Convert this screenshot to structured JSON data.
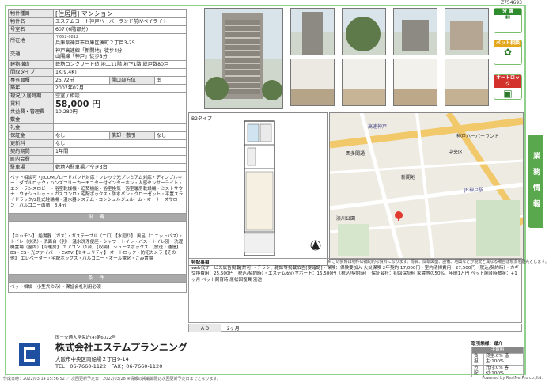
{
  "doc_id": "Z754693",
  "property": {
    "type_label": "物件種目",
    "type_value": "[住居用] マンション",
    "name_label": "物件名",
    "name_value": "エステムコート神戸ハーバーランド前IVベイライト",
    "room_label": "号室名",
    "room_value": "607 (6階部分)",
    "address_label": "所在地",
    "address_zip": "〒652-0812",
    "address_value": "兵庫県神戸市兵庫区湊町２丁目3-25",
    "traffic_label": "交通",
    "traffic_1": "神戸高速線「新開地」徒歩4分",
    "traffic_2": "山陽線「神戸」徒歩8分",
    "structure_label": "建物構造",
    "structure_value": "鉄筋コンクリート造 地上11階 地下1階 総戸数80戸",
    "layout_label": "間取タイプ",
    "layout_value": "1K[9.4K]",
    "area_label": "専有面積",
    "area_value": "25.72㎡",
    "direction_label": "開口部方位",
    "direction_value": "南",
    "built_label": "築年",
    "built_value": "2007年02月",
    "status_label": "現況/入居時期",
    "status_value": "空室 / 相談",
    "rent_label": "賃料",
    "rent_value": "58,000 円",
    "mgmt_label": "共益費・管理費",
    "mgmt_value": "10,280円",
    "deposit_label": "敷金",
    "deposit_value": "",
    "key_label": "礼金",
    "key_value": "",
    "guarantee_label": "保証金",
    "guarantee_value": "なし",
    "amort_label": "償却・敷引",
    "amort_value": "なし",
    "renew_label": "更新料",
    "renew_value": "なし",
    "contract_label": "契約期間",
    "contract_value": "1年間",
    "town_label": "町内会費",
    "town_value": "",
    "parking_label": "駐車場",
    "parking_value": "敷地内駐車場／空き3台"
  },
  "features_text": "ペット相談可・J:COMブロードバンド対応・フレッツ光プレミアム対応・ディンプルキー・ダブルロック・ハンズフリーカーモニター付インターホン・人感センサーライト・エントランスロビー・浴室乾燥機・追焚機能・浴室換気・浴室暖房乾燥機・ミストサウナ・ウォシュレット・ガスコンロ・宅配ボックス・防水パン・クローゼット・平置スライドラック/2段式駐輪場・温水器システム・コンシェルジュルーム・オーナーズサロン・バルコニー面積：3.4㎡",
  "equipment_title": "設 備",
  "equipment_text": "【キッチン】 給湯器（ガス）・ガステーブル（二口）【水廻り】 風呂（ユニットバス）・トイレ（水洗）・洗面台（別）・温水洗浄便座・シャワートイレ・バス・トイレ別・洗濯機置場（室内）【冷暖房】 エアコン（1台）【収納】 シューズボックス 【放送・通信】 BS・CS・光ファイバー・CATV【セキュリティ】 オートロック・防犯カメラ【その他】 エレベーター・宅配ボックス・バルコニー・オール電化・ごみ置場",
  "conditions_title": "条 件",
  "conditions_text": "ペット相談（小型犬のみ）・保証会社利用必須",
  "floorplan_label": "B2タイプ",
  "map_note": "※ この資料は物件の補助的な資料になります。写真、間取図面、設備、地図などが現況と異なる場合は現況を優先とします。",
  "map_labels": [
    "高速神戸",
    "西多聞通",
    "中央区",
    "神戸ハーバーランド",
    "新開地",
    "湊川公園",
    "JR神戸駅"
  ],
  "remarks_title": "特記事項",
  "remarks_text": "web代サービス広告掲載[許可]・チラシ、雑誌等掲載広告[要確認]・保険：保険要加入 火災保険 2年契約 17,000円・室内清掃費用：27,500円（税込/契約時）・カギ交換費用：25,500円（税込/契約時）・エステム安心サポート：16,500円（税込/契約時）・保証会社：初回保証料 家賃等の50%、年間1万円 ペット飼育時敷金：+1ヶ月 ペット飼育時 原状回復費 別途",
  "ad_label": "ＡＤ",
  "ad_value": "2ヶ月",
  "company": {
    "license": "国土交通大臣免許(4)第6022号",
    "name": "株式会社エステムプランニング",
    "address": "大阪市中央区南船場２丁目9-14",
    "tel": "TEL：06-7660-1122　FAX：06-7660-1120"
  },
  "fees": {
    "title": "取引態様：媒介",
    "sub": "手数料",
    "rows": [
      [
        "負担",
        "貸主:0% 借主:100%"
      ],
      [
        "分配",
        "元付:0% 客付:100%"
      ]
    ]
  },
  "badges": [
    {
      "top": "分 譲",
      "body": "分譲"
    },
    {
      "top": "ペット相談",
      "body": "ペット"
    },
    {
      "top": "オートロック",
      "body": "ロック"
    }
  ],
  "side_tab": "業 務 情 報",
  "footer_left": "作成日時：2022/03/14 15:56:52 ／ 次回更新予定日：2022/03/28 ※情報の掲載期限は次回更新予定日までとなります。",
  "footer_right": "Powered by RealNetPro co.,ltd."
}
